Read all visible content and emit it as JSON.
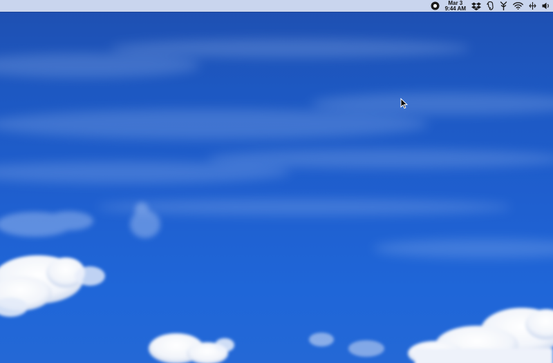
{
  "desktop": {
    "wallpaper": "blue-sky-clouds",
    "colors": {
      "sky_top": "#1f4fb0",
      "sky_bottom": "#2468d6",
      "menubar": "#d6e0f2"
    }
  },
  "menubar": {
    "status_items": [
      {
        "icon": "record-icon"
      },
      {
        "icon": "dropbox-icon"
      },
      {
        "icon": "evernote-icon"
      },
      {
        "icon": "antenna-icon"
      },
      {
        "icon": "wifi-icon"
      },
      {
        "icon": "input-source-icon"
      },
      {
        "icon": "volume-icon"
      }
    ],
    "clock": {
      "date": "Mar 3",
      "time": "9:44 AM"
    }
  }
}
